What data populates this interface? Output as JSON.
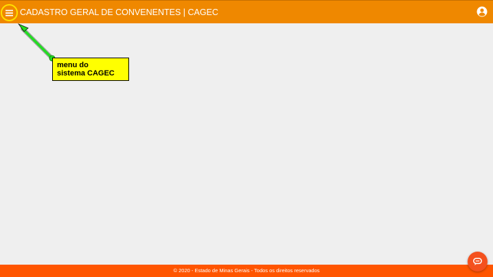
{
  "header": {
    "title": "CADASTRO GERAL DE CONVENENTES | CAGEC",
    "menu_icon": "hamburger-menu-icon",
    "user_icon": "user-account-icon"
  },
  "annotation": {
    "line1": "menu do",
    "line2": "sistema CAGEC"
  },
  "footer": {
    "text": "© 2020 - Estado de Minas Gerais - Todos os direitos reservados"
  },
  "chat": {
    "icon": "chat-bubble-icon"
  },
  "colors": {
    "header": "#ef8800",
    "footer": "#ff5500",
    "menu_ring": "#ffe000",
    "callout_bg": "#ffff00",
    "arrow": "#22dd22",
    "chat_button": "#f4511e",
    "page_bg": "#efefef"
  }
}
